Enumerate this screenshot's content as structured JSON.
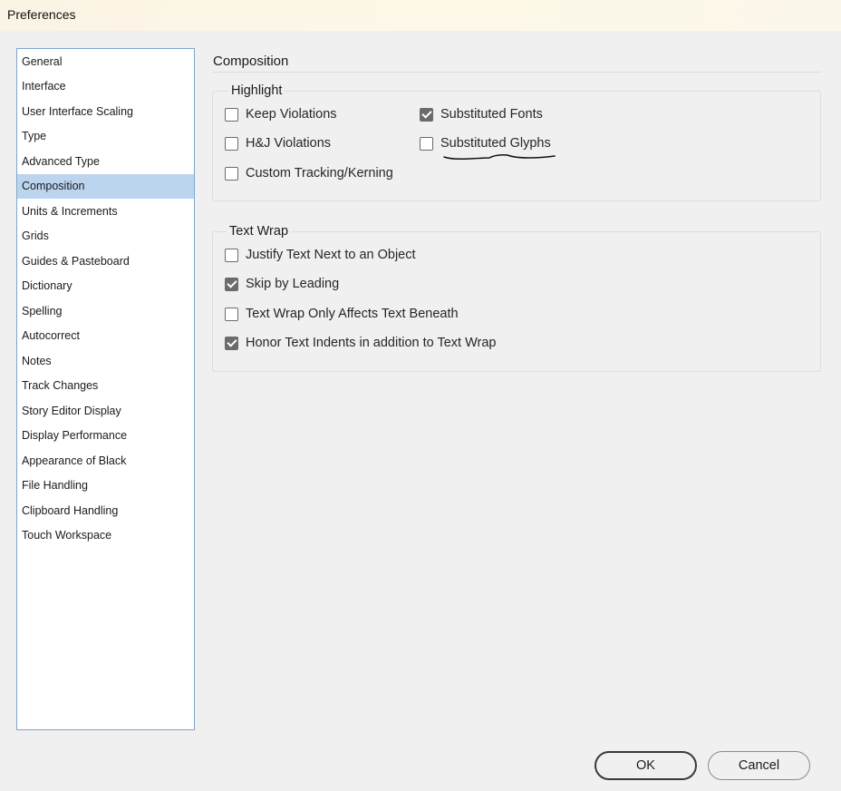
{
  "window": {
    "title": "Preferences"
  },
  "sidebar": {
    "selected": "Composition",
    "items": [
      "General",
      "Interface",
      "User Interface Scaling",
      "Type",
      "Advanced Type",
      "Composition",
      "Units & Increments",
      "Grids",
      "Guides & Pasteboard",
      "Dictionary",
      "Spelling",
      "Autocorrect",
      "Notes",
      "Track Changes",
      "Story Editor Display",
      "Display Performance",
      "Appearance of Black",
      "File Handling",
      "Clipboard Handling",
      "Touch Workspace"
    ]
  },
  "panel": {
    "title": "Composition"
  },
  "highlight": {
    "label": "Highlight",
    "keep_violations": {
      "label": "Keep Violations",
      "checked": false
    },
    "hj_violations": {
      "label": "H&J Violations",
      "checked": false
    },
    "custom_tracking": {
      "label": "Custom Tracking/Kerning",
      "checked": false
    },
    "substituted_fonts": {
      "label": "Substituted Fonts",
      "checked": true
    },
    "substituted_glyphs": {
      "label": "Substituted Glyphs",
      "checked": false
    }
  },
  "text_wrap": {
    "label": "Text Wrap",
    "justify_text": {
      "label": "Justify Text Next to an Object",
      "checked": false
    },
    "skip_by_leading": {
      "label": "Skip by Leading",
      "checked": true
    },
    "affects_beneath": {
      "label": "Text Wrap Only Affects Text Beneath",
      "checked": false
    },
    "honor_indents": {
      "label": "Honor Text Indents in addition to Text Wrap",
      "checked": true
    }
  },
  "buttons": {
    "ok": "OK",
    "cancel": "Cancel"
  },
  "colors": {
    "selection": "#bcd5ee",
    "sidebar_border": "#7fa6cf",
    "checkbox_checked": "#6b6b6b",
    "background": "#f0f0f0"
  }
}
